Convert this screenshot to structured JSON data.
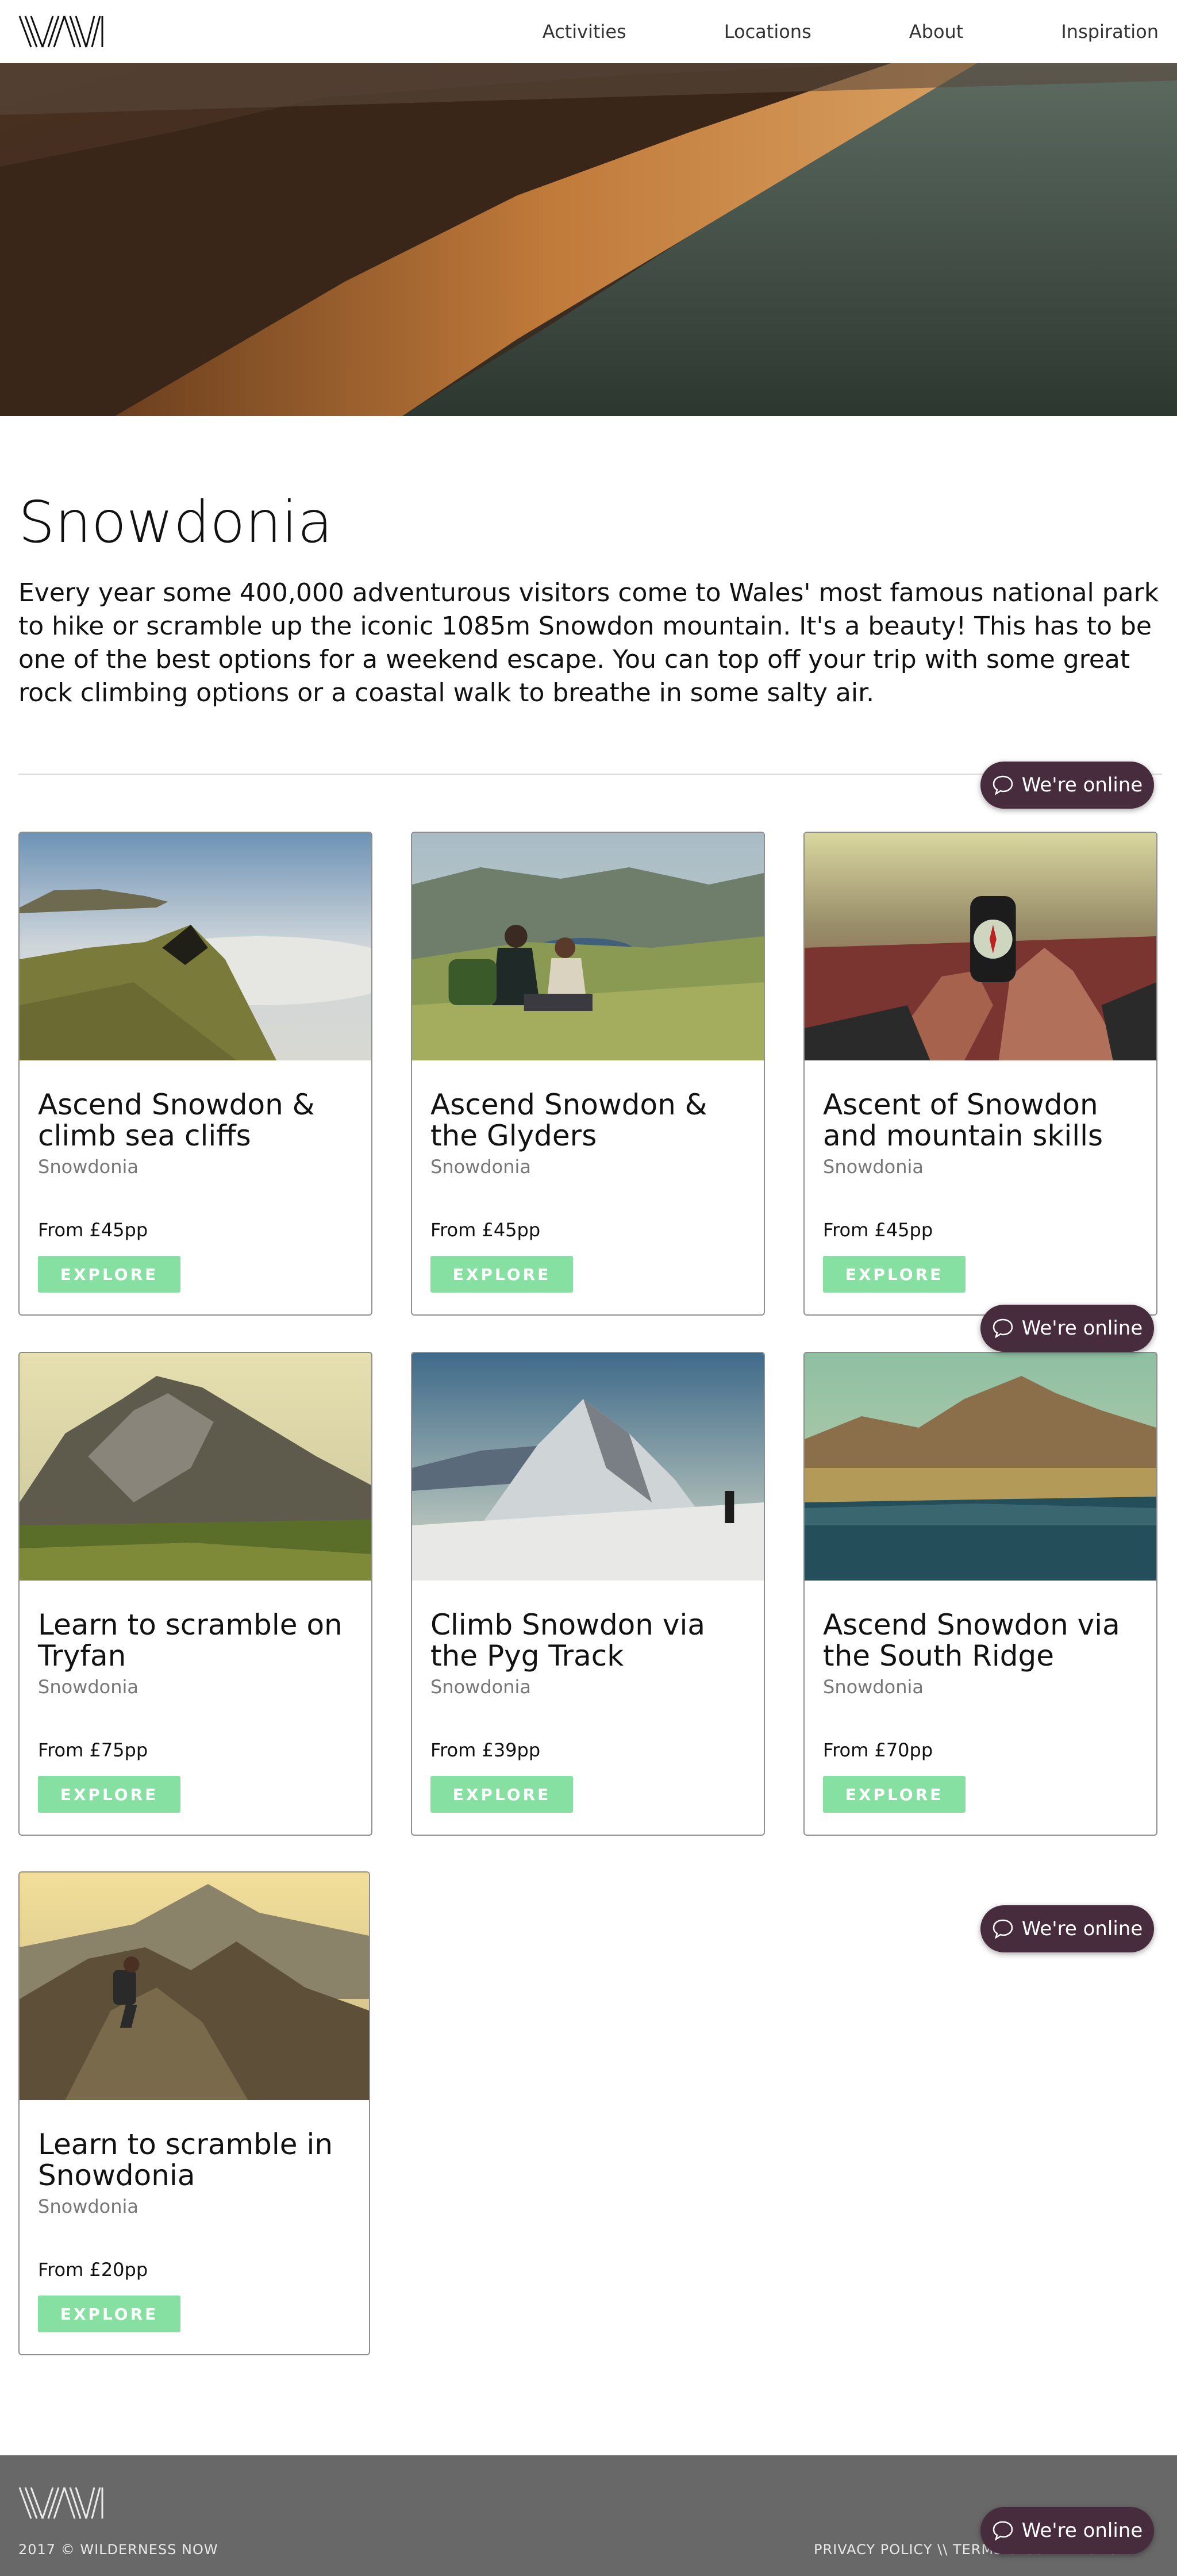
{
  "header": {
    "nav": [
      "Activities",
      "Locations",
      "About",
      "Inspiration"
    ]
  },
  "page": {
    "title": "Snowdonia",
    "intro": "Every year some 400,000 adventurous visitors come to Wales' most famous national park to hike or scramble up the iconic 1085m Snowdon mountain. It's a beauty! This has to be one of the best options for a weekend escape. You can top off your trip with some great rock climbing options or a coastal walk to breathe in some salty air."
  },
  "cards": [
    {
      "title": "Ascend Snowdon & climb sea cliffs",
      "location": "Snowdonia",
      "price": "From £45pp",
      "button": "EXPLORE"
    },
    {
      "title": "Ascend Snowdon & the Glyders",
      "location": "Snowdonia",
      "price": "From £45pp",
      "button": "EXPLORE"
    },
    {
      "title": "Ascent of Snowdon and mountain skills",
      "location": "Snowdonia",
      "price": "From £45pp",
      "button": "EXPLORE"
    },
    {
      "title": "Learn to scramble on Tryfan",
      "location": "Snowdonia",
      "price": "From £75pp",
      "button": "EXPLORE"
    },
    {
      "title": "Climb Snowdon via the Pyg Track",
      "location": "Snowdonia",
      "price": "From £39pp",
      "button": "EXPLORE"
    },
    {
      "title": "Ascend Snowdon via the South Ridge",
      "location": "Snowdonia",
      "price": "From £70pp",
      "button": "EXPLORE"
    },
    {
      "title": "Learn to scramble in Snowdonia",
      "location": "Snowdonia",
      "price": "From £20pp",
      "button": "EXPLORE"
    }
  ],
  "chat": {
    "label": "We're online",
    "icon": "speech-bubble-icon"
  },
  "footer": {
    "copyright": "2017 © WILDERNESS NOW",
    "links": "PRIVACY POLICY \\\\ TERMS & CONDITIONS"
  },
  "colors": {
    "explore_button": "#86e0a2",
    "chat_widget": "#472c3d",
    "footer": "#686868"
  }
}
